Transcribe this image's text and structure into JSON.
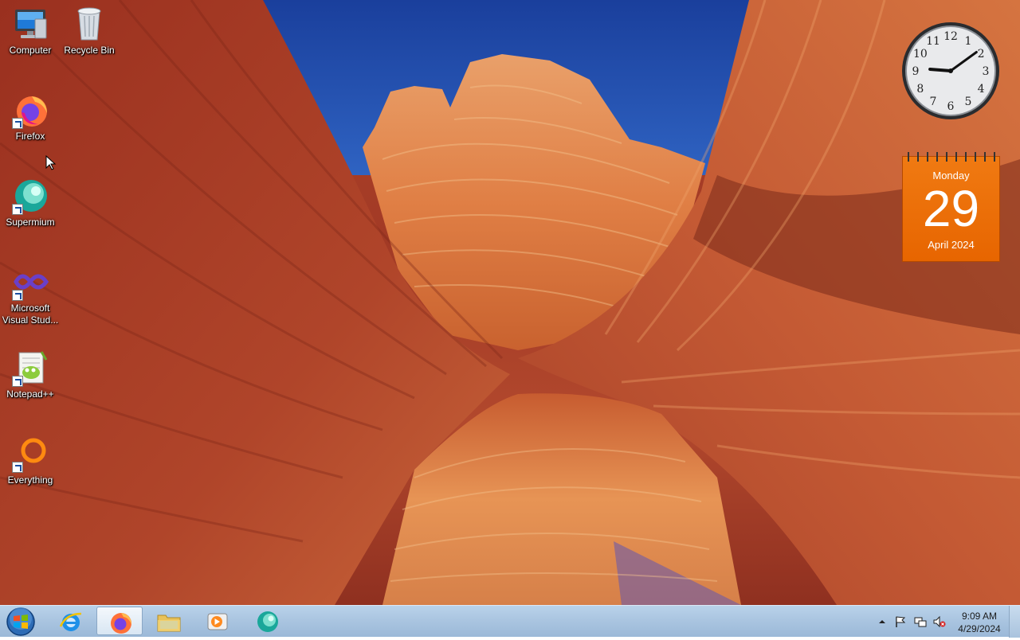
{
  "desktop": {
    "icons": [
      {
        "label": "Computer",
        "icon": "computer-icon"
      },
      {
        "label": "Recycle Bin",
        "icon": "recycle-bin-icon"
      },
      {
        "label": "Firefox",
        "icon": "firefox-icon"
      },
      {
        "label": "Supermium",
        "icon": "supermium-icon"
      },
      {
        "label": "Microsoft Visual Stud...",
        "icon": "visual-studio-icon"
      },
      {
        "label": "Notepad++",
        "icon": "notepadpp-icon"
      },
      {
        "label": "Everything",
        "icon": "everything-icon"
      }
    ]
  },
  "gadgets": {
    "clock": {
      "hour": 9,
      "minute": 9,
      "numerals": [
        "12",
        "1",
        "2",
        "3",
        "4",
        "5",
        "6",
        "7",
        "8",
        "9",
        "10",
        "11"
      ]
    },
    "calendar": {
      "weekday": "Monday",
      "day": "29",
      "month_year": "April 2024"
    }
  },
  "taskbar": {
    "pinned": [
      {
        "name": "internet-explorer",
        "icon": "ie-icon",
        "active": false
      },
      {
        "name": "firefox",
        "icon": "firefox-icon",
        "active": true
      },
      {
        "name": "file-explorer",
        "icon": "folder-icon",
        "active": false
      },
      {
        "name": "media-player",
        "icon": "media-player-icon",
        "active": false
      },
      {
        "name": "supermium",
        "icon": "supermium-icon",
        "active": false
      }
    ],
    "tray": {
      "icons": [
        "show-hidden-icons-icon",
        "action-center-flag-icon",
        "network-icon",
        "volume-muted-icon"
      ],
      "time": "9:09 AM",
      "date": "4/29/2024"
    }
  },
  "colors": {
    "calendar_orange": "#e76500",
    "taskbar_blue": "#a9c4e0",
    "sky_blue": "#1c48a8"
  }
}
